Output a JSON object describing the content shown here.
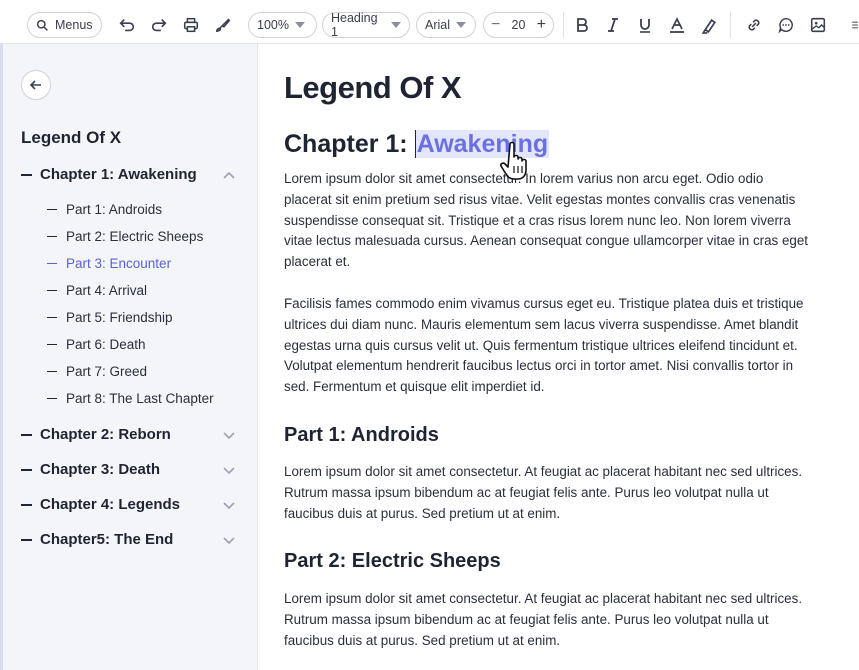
{
  "toolbar": {
    "menus_label": "Menus",
    "zoom": "100%",
    "style": "Heading 1",
    "font": "Arial",
    "font_size": "20",
    "icons": [
      "search-icon",
      "undo-icon",
      "redo-icon",
      "print-icon",
      "paint-format-icon",
      "minus-icon",
      "plus-icon",
      "bold-icon",
      "italic-icon",
      "underline-icon",
      "text-color-icon",
      "highlight-icon",
      "link-icon",
      "comment-icon",
      "image-icon",
      "more-icon"
    ]
  },
  "sidebar": {
    "title": "Legend Of X",
    "chapters": [
      {
        "label": "Chapter 1: Awakening",
        "expanded": true,
        "parts": [
          "Part 1: Androids",
          "Part 2: Electric Sheeps",
          "Part 3: Encounter",
          "Part 4: Arrival",
          "Part 5: Friendship",
          "Part 6: Death",
          "Part 7: Greed",
          "Part 8: The Last Chapter"
        ]
      },
      {
        "label": "Chapter 2: Reborn"
      },
      {
        "label": "Chapter 3: Death"
      },
      {
        "label": "Chapter 4: Legends"
      },
      {
        "label": "Chapter5: The End"
      }
    ],
    "active_part": "Part 3: Encounter"
  },
  "document": {
    "title": "Legend Of X",
    "chapter_prefix": "Chapter 1: ",
    "chapter_selected": "Awakening",
    "paragraphs": [
      "Lorem ipsum dolor sit amet consectetur. In lorem varius non arcu eget. Odio odio placerat sit enim pretium sed risus vitae. Velit egestas montes convallis cras venenatis suspendisse consequat sit. Tristique et a cras risus lorem nunc leo. Non lorem viverra vitae lectus malesuada cursus. Aenean consequat congue ullamcorper vitae in cras eget placerat et.",
      "Facilisis fames commodo enim vivamus cursus eget eu. Tristique platea duis et tristique ultrices dui diam nunc. Mauris elementum sem lacus viverra suspendisse. Amet blandit egestas urna quis cursus velit ut. Quis fermentum tristique ultrices eleifend tincidunt et. Volutpat elementum hendrerit faucibus lectus orci in tortor amet. Nisi convallis tortor in sed. Fermentum et quisque elit imperdiet id."
    ],
    "part1_heading": "Part 1: Androids",
    "part1_text": "Lorem ipsum dolor sit amet consectetur. At feugiat ac placerat habitant nec sed ultrices. Rutrum massa ipsum bibendum ac at feugiat felis ante. Purus leo volutpat nulla ut faucibus duis at purus. Sed pretium ut at enim.",
    "part2_heading": "Part 2: Electric Sheeps",
    "part2_text": "Lorem ipsum dolor sit amet consectetur. At feugiat ac placerat habitant nec sed ultrices. Rutrum massa ipsum bibendum ac at feugiat felis ante. Purus leo volutpat nulla ut faucibus duis at purus. Sed pretium ut at enim."
  },
  "colors": {
    "accent": "#5b5fd6",
    "selection": "#e3e6fb",
    "sidebar_bg": "#f4f5f8"
  }
}
